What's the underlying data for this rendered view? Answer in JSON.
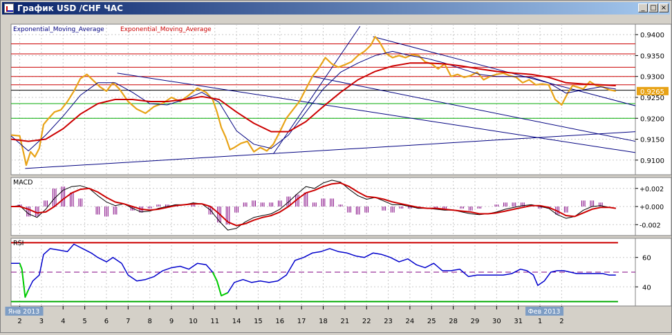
{
  "window": {
    "title": "График USD /CHF ЧАС",
    "buttons": {
      "minimize": "_",
      "maximize": "□",
      "close": "×"
    }
  },
  "colors": {
    "price": "#e8a317",
    "ema_fast": "#000080",
    "ema_slow": "#cc0000",
    "resistance": "#cc0000",
    "support": "#00aa00",
    "trend": "#000080",
    "current_label_bg": "#e8a317",
    "macd_hist": "#800080"
  },
  "chart_data": [
    {
      "type": "line",
      "panel": "price",
      "legend": [
        "Exponential_Moving_Average",
        "Exponential_Moving_Average"
      ],
      "ylim": [
        0.9065,
        0.9425
      ],
      "y_ticks": [
        0.94,
        0.935,
        0.93,
        0.925,
        0.92,
        0.915,
        0.91
      ],
      "y_tick_labels": [
        "0.9400",
        "0.9350",
        "0.9300",
        "0.9250",
        "0.9200",
        "0.9150",
        "0.9100"
      ],
      "current_value": 0.9265,
      "current_label": "0.9265",
      "x_day_start": 1.6,
      "x_day_end": 30.4,
      "horizontal_levels": [
        {
          "value": 0.9378,
          "kind": "resistance"
        },
        {
          "value": 0.9354,
          "kind": "resistance"
        },
        {
          "value": 0.9322,
          "kind": "resistance"
        },
        {
          "value": 0.93,
          "kind": "resistance"
        },
        {
          "value": 0.928,
          "kind": "resistance"
        },
        {
          "value": 0.9267,
          "kind": "current"
        },
        {
          "value": 0.9235,
          "kind": "support"
        },
        {
          "value": 0.92,
          "kind": "support"
        }
      ],
      "trendlines": [
        {
          "x1": 2.25,
          "y1": 0.908,
          "x2": 30.4,
          "y2": 0.9168
        },
        {
          "x1": 6.5,
          "y1": 0.9308,
          "x2": 30.4,
          "y2": 0.9118
        },
        {
          "x1": 13.7,
          "y1": 0.9115,
          "x2": 17.7,
          "y2": 0.942
        },
        {
          "x1": 18.3,
          "y1": 0.9395,
          "x2": 30.4,
          "y2": 0.923
        },
        {
          "x1": 15.5,
          "y1": 0.93,
          "x2": 30.4,
          "y2": 0.9145
        }
      ],
      "series": [
        {
          "role": "price",
          "x": [
            1.6,
            2.0,
            2.2,
            2.3,
            2.5,
            2.7,
            2.9,
            3.1,
            3.3,
            3.6,
            3.9,
            4.2,
            4.5,
            4.8,
            5.1,
            5.4,
            5.7,
            6.0,
            6.3,
            6.6,
            7.0,
            7.4,
            7.8,
            8.2,
            8.6,
            9.0,
            9.4,
            9.8,
            10.2,
            10.6,
            10.9,
            11.1,
            11.3,
            11.5,
            11.7,
            11.9,
            12.2,
            12.5,
            12.8,
            13.1,
            13.4,
            13.7,
            14.0,
            14.3,
            14.6,
            14.9,
            15.2,
            15.5,
            15.8,
            16.1,
            16.4,
            16.7,
            17.0,
            17.3,
            17.6,
            17.9,
            18.2,
            18.4,
            18.6,
            18.9,
            19.2,
            19.5,
            19.8,
            20.1,
            20.4,
            20.7,
            21.0,
            21.3,
            21.6,
            21.9,
            22.2,
            22.5,
            22.8,
            23.1,
            23.4,
            23.7,
            24.0,
            24.3,
            24.6,
            24.9,
            25.2,
            25.5,
            25.8,
            26.1,
            26.4,
            26.7,
            27.0,
            27.3,
            27.5,
            27.7,
            28.0,
            28.3,
            28.6,
            28.9,
            29.2,
            29.5
          ],
          "values": [
            0.916,
            0.9158,
            0.9112,
            0.9088,
            0.912,
            0.9108,
            0.9128,
            0.9185,
            0.9198,
            0.9215,
            0.922,
            0.924,
            0.9265,
            0.9295,
            0.9305,
            0.929,
            0.9275,
            0.9265,
            0.9285,
            0.927,
            0.924,
            0.9222,
            0.9212,
            0.9228,
            0.9236,
            0.925,
            0.924,
            0.9255,
            0.9272,
            0.9262,
            0.9245,
            0.9215,
            0.9178,
            0.9155,
            0.9125,
            0.913,
            0.914,
            0.9145,
            0.912,
            0.913,
            0.9122,
            0.9138,
            0.9168,
            0.92,
            0.922,
            0.924,
            0.927,
            0.93,
            0.932,
            0.9345,
            0.933,
            0.9322,
            0.9328,
            0.9335,
            0.935,
            0.936,
            0.9375,
            0.9395,
            0.9382,
            0.9355,
            0.9345,
            0.935,
            0.9345,
            0.9352,
            0.935,
            0.9335,
            0.933,
            0.9318,
            0.933,
            0.93,
            0.9305,
            0.9298,
            0.9302,
            0.931,
            0.9292,
            0.93,
            0.9305,
            0.9308,
            0.9302,
            0.9298,
            0.9285,
            0.9292,
            0.928,
            0.9282,
            0.928,
            0.9245,
            0.9232,
            0.9262,
            0.9278,
            0.9275,
            0.927,
            0.9288,
            0.9278,
            0.9275,
            0.9268,
            0.9265
          ]
        },
        {
          "name": "Exponential_Moving_Average",
          "role": "ema_fast",
          "x": [
            1.6,
            2.4,
            3.2,
            4.0,
            4.8,
            5.6,
            6.4,
            7.2,
            8.0,
            8.8,
            9.6,
            10.4,
            11.2,
            12.0,
            12.8,
            13.6,
            14.4,
            15.2,
            16.0,
            16.8,
            17.6,
            18.4,
            19.2,
            20.0,
            20.8,
            21.6,
            22.4,
            23.2,
            24.0,
            24.8,
            25.6,
            26.4,
            27.2,
            28.0,
            28.8,
            29.5
          ],
          "values": [
            0.9158,
            0.9122,
            0.916,
            0.9205,
            0.9255,
            0.9285,
            0.9285,
            0.9262,
            0.9235,
            0.9232,
            0.9245,
            0.9262,
            0.9238,
            0.917,
            0.9138,
            0.9128,
            0.916,
            0.9215,
            0.927,
            0.931,
            0.9332,
            0.935,
            0.936,
            0.935,
            0.9343,
            0.9332,
            0.9318,
            0.9305,
            0.93,
            0.93,
            0.9298,
            0.9285,
            0.926,
            0.9268,
            0.9275,
            0.927
          ]
        },
        {
          "name": "Exponential_Moving_Average",
          "role": "ema_slow",
          "x": [
            1.6,
            2.4,
            3.2,
            4.0,
            4.8,
            5.6,
            6.4,
            7.2,
            8.0,
            8.8,
            9.6,
            10.4,
            11.2,
            12.0,
            12.8,
            13.6,
            14.4,
            15.2,
            16.0,
            16.8,
            17.6,
            18.4,
            19.2,
            20.0,
            20.8,
            21.6,
            22.4,
            23.2,
            24.0,
            24.8,
            25.6,
            26.4,
            27.2,
            28.0,
            28.8,
            29.5
          ],
          "values": [
            0.915,
            0.9145,
            0.915,
            0.9175,
            0.921,
            0.9235,
            0.9245,
            0.9245,
            0.924,
            0.924,
            0.9245,
            0.9252,
            0.9245,
            0.9215,
            0.9188,
            0.9168,
            0.9168,
            0.9192,
            0.9228,
            0.9262,
            0.9292,
            0.9312,
            0.9325,
            0.9332,
            0.9332,
            0.933,
            0.9325,
            0.9318,
            0.9312,
            0.9308,
            0.9305,
            0.9298,
            0.9285,
            0.9282,
            0.928,
            0.9278
          ]
        }
      ]
    },
    {
      "type": "line",
      "panel": "macd",
      "title": "MACD",
      "ylim": [
        -0.0032,
        0.0032
      ],
      "y_ticks": [
        0.002,
        0.0,
        -0.002
      ],
      "y_tick_labels": [
        "+0.002",
        "+0.000",
        "-0.002"
      ],
      "series": [
        {
          "role": "macd",
          "x": [
            1.6,
            2.0,
            2.4,
            2.8,
            3.2,
            3.6,
            4.0,
            4.4,
            4.8,
            5.2,
            5.6,
            6.0,
            6.4,
            6.8,
            7.2,
            7.6,
            8.0,
            8.4,
            8.8,
            9.2,
            9.6,
            10.0,
            10.4,
            10.8,
            11.2,
            11.6,
            12.0,
            12.4,
            12.8,
            13.2,
            13.6,
            14.0,
            14.4,
            14.8,
            15.2,
            15.6,
            16.0,
            16.4,
            16.8,
            17.2,
            17.6,
            18.0,
            18.4,
            18.8,
            19.2,
            19.6,
            20.0,
            20.4,
            20.8,
            21.2,
            21.6,
            22.0,
            22.4,
            22.8,
            23.2,
            23.6,
            24.0,
            24.4,
            24.8,
            25.2,
            25.6,
            26.0,
            26.4,
            26.8,
            27.2,
            27.6,
            28.0,
            28.4,
            28.8,
            29.2,
            29.5
          ],
          "values": [
            0.0,
            0.0001,
            -0.0008,
            -0.0012,
            -0.0003,
            0.0009,
            0.0018,
            0.0022,
            0.0023,
            0.002,
            0.0012,
            0.0005,
            0.0001,
            0.0003,
            -0.0002,
            -0.0006,
            -0.0005,
            -0.0002,
            0.0,
            0.0002,
            0.0002,
            0.0004,
            0.0003,
            -0.0004,
            -0.0016,
            -0.0026,
            -0.0024,
            -0.0017,
            -0.0012,
            -0.001,
            -0.0008,
            -0.0003,
            0.0005,
            0.0014,
            0.0022,
            0.002,
            0.0026,
            0.0029,
            0.0027,
            0.0019,
            0.0012,
            0.0008,
            0.001,
            0.0006,
            0.0002,
            0.0002,
            0.0,
            -0.0002,
            -0.0002,
            -0.0003,
            -0.0004,
            -0.0004,
            -0.0006,
            -0.0008,
            -0.0009,
            -0.0008,
            -0.0006,
            -0.0003,
            -0.0001,
            0.0001,
            0.0002,
            0.0,
            -0.0002,
            -0.0009,
            -0.0013,
            -0.0011,
            -0.0004,
            0.0,
            0.0001,
            -0.0001,
            -0.0002
          ]
        },
        {
          "role": "signal",
          "x": [
            1.6,
            2.0,
            2.4,
            2.8,
            3.2,
            3.6,
            4.0,
            4.4,
            4.8,
            5.2,
            5.6,
            6.0,
            6.4,
            6.8,
            7.2,
            7.6,
            8.0,
            8.4,
            8.8,
            9.2,
            9.6,
            10.0,
            10.4,
            10.8,
            11.2,
            11.6,
            12.0,
            12.4,
            12.8,
            13.2,
            13.6,
            14.0,
            14.4,
            14.8,
            15.2,
            15.6,
            16.0,
            16.4,
            16.8,
            17.2,
            17.6,
            18.0,
            18.4,
            18.8,
            19.2,
            19.6,
            20.0,
            20.4,
            20.8,
            21.2,
            21.6,
            22.0,
            22.4,
            22.8,
            23.2,
            23.6,
            24.0,
            24.4,
            24.8,
            25.2,
            25.6,
            26.0,
            26.4,
            26.8,
            27.2,
            27.6,
            28.0,
            28.4,
            28.8,
            29.2,
            29.5
          ],
          "values": [
            0.0,
            0.0,
            -0.0003,
            -0.0007,
            -0.0006,
            0.0,
            0.0008,
            0.0015,
            0.0019,
            0.002,
            0.0016,
            0.001,
            0.0005,
            0.0003,
            0.0,
            -0.0003,
            -0.0004,
            -0.0003,
            -0.0001,
            0.0001,
            0.0002,
            0.0003,
            0.0003,
            0.0,
            -0.0008,
            -0.0017,
            -0.0021,
            -0.0019,
            -0.0015,
            -0.0012,
            -0.001,
            -0.0006,
            0.0,
            0.0008,
            0.0015,
            0.0018,
            0.0022,
            0.0025,
            0.0026,
            0.0022,
            0.0016,
            0.0011,
            0.001,
            0.0008,
            0.0005,
            0.0003,
            0.0001,
            -0.0001,
            -0.0002,
            -0.0002,
            -0.0003,
            -0.0004,
            -0.0005,
            -0.0006,
            -0.0008,
            -0.0008,
            -0.0007,
            -0.0005,
            -0.0003,
            -0.0001,
            0.0001,
            0.0001,
            -0.0001,
            -0.0005,
            -0.001,
            -0.0011,
            -0.0007,
            -0.0003,
            -0.0001,
            -0.0001,
            -0.0002
          ]
        }
      ]
    },
    {
      "type": "line",
      "panel": "rsi",
      "title": "RSI",
      "ylim": [
        27,
        73
      ],
      "y_ticks": [
        60,
        40
      ],
      "y_tick_labels": [
        "60",
        "40"
      ],
      "levels": [
        {
          "value": 70,
          "kind": "overbought"
        },
        {
          "value": 50,
          "kind": "middle"
        },
        {
          "value": 30,
          "kind": "oversold"
        }
      ],
      "series": [
        {
          "role": "rsi",
          "x": [
            1.6,
            2.0,
            2.1,
            2.25,
            2.4,
            2.6,
            2.9,
            3.1,
            3.4,
            3.8,
            4.2,
            4.5,
            4.9,
            5.3,
            5.6,
            6.0,
            6.3,
            6.7,
            7.0,
            7.4,
            7.8,
            8.2,
            8.6,
            9.0,
            9.4,
            9.8,
            10.2,
            10.6,
            10.9,
            11.1,
            11.3,
            11.6,
            11.9,
            12.3,
            12.7,
            13.1,
            13.5,
            13.9,
            14.3,
            14.7,
            15.1,
            15.5,
            15.9,
            16.3,
            16.7,
            17.1,
            17.5,
            17.9,
            18.3,
            18.7,
            19.1,
            19.5,
            19.9,
            20.3,
            20.7,
            21.1,
            21.5,
            21.9,
            22.3,
            22.7,
            23.1,
            23.5,
            23.9,
            24.3,
            24.7,
            25.1,
            25.4,
            25.7,
            25.9,
            26.2,
            26.5,
            26.8,
            27.1,
            27.4,
            27.7,
            28.0,
            28.3,
            28.6,
            28.9,
            29.2,
            29.5
          ],
          "values": [
            56,
            56,
            52,
            33,
            38,
            44,
            48,
            62,
            66,
            65,
            64,
            69,
            66,
            63,
            60,
            57,
            60,
            56,
            48,
            44,
            45,
            47,
            51,
            53,
            54,
            52,
            56,
            55,
            50,
            44,
            34,
            36,
            43,
            45,
            43,
            44,
            43,
            44,
            48,
            58,
            60,
            63,
            64,
            66,
            64,
            63,
            61,
            60,
            63,
            62,
            60,
            57,
            59,
            55,
            53,
            56,
            51,
            51,
            52,
            47,
            48,
            48,
            48,
            48,
            49,
            52,
            51,
            48,
            41,
            44,
            50,
            51,
            51,
            50,
            49,
            49,
            49,
            49,
            49,
            48,
            48
          ]
        }
      ]
    }
  ],
  "x_axis": {
    "ticks": [
      {
        "day": 2,
        "label": "2"
      },
      {
        "day": 3,
        "label": "3"
      },
      {
        "day": 4,
        "label": "4"
      },
      {
        "day": 5,
        "label": "5"
      },
      {
        "day": 6,
        "label": "6"
      },
      {
        "day": 7,
        "label": "7"
      },
      {
        "day": 8,
        "label": "8"
      },
      {
        "day": 9,
        "label": "9"
      },
      {
        "day": 10,
        "label": "10"
      },
      {
        "day": 11,
        "label": "11"
      },
      {
        "day": 12,
        "label": "14"
      },
      {
        "day": 13,
        "label": "15"
      },
      {
        "day": 14,
        "label": "16"
      },
      {
        "day": 15,
        "label": "17"
      },
      {
        "day": 16,
        "label": "18"
      },
      {
        "day": 17,
        "label": "21"
      },
      {
        "day": 18,
        "label": "22"
      },
      {
        "day": 19,
        "label": "23"
      },
      {
        "day": 20,
        "label": "24"
      },
      {
        "day": 21,
        "label": "25"
      },
      {
        "day": 22,
        "label": "28"
      },
      {
        "day": 23,
        "label": "29"
      },
      {
        "day": 24,
        "label": "30"
      },
      {
        "day": 25,
        "label": "31"
      },
      {
        "day": 26,
        "label": "1"
      },
      {
        "day": 27,
        "label": "2"
      }
    ],
    "month_markers": [
      {
        "day": 2,
        "label": "Янв 2013"
      },
      {
        "day": 26,
        "label": "Фев 2013"
      }
    ]
  }
}
